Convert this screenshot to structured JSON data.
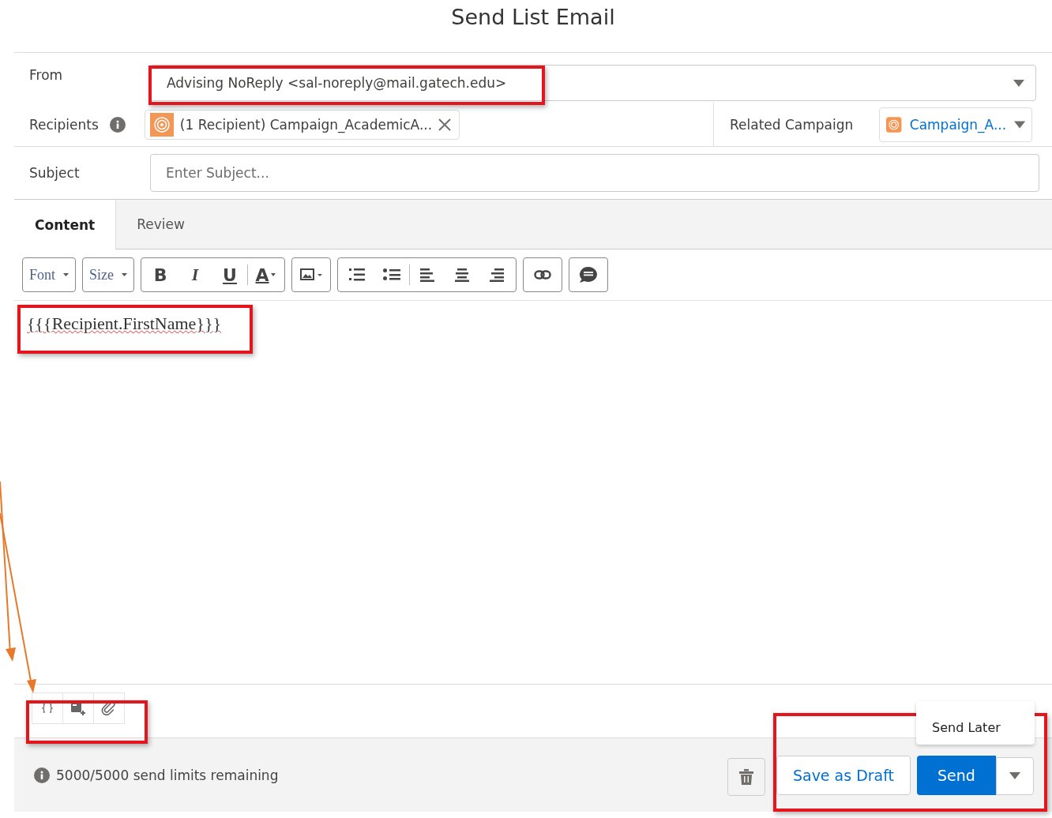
{
  "title": "Send List Email",
  "from": {
    "label": "From",
    "value": "Advising NoReply <sal-noreply@mail.gatech.edu>"
  },
  "recipients": {
    "label": "Recipients",
    "pill": "(1 Recipient) Campaign_AcademicA..."
  },
  "related_campaign": {
    "label": "Related Campaign",
    "value": "Campaign_A..."
  },
  "subject": {
    "label": "Subject",
    "placeholder": "Enter Subject..."
  },
  "tabs": [
    {
      "label": "Content",
      "selected": true
    },
    {
      "label": "Review",
      "selected": false
    }
  ],
  "toolbar": {
    "font": "Font",
    "size": "Size",
    "bold": "B",
    "italic": "I",
    "underline": "U",
    "text_color": "A"
  },
  "body": "{{{Recipient.FirstName}}}",
  "footer": {
    "limits": "5000/5000 send limits remaining",
    "save_draft": "Save as Draft",
    "send": "Send",
    "menu": [
      "Send Later"
    ]
  }
}
